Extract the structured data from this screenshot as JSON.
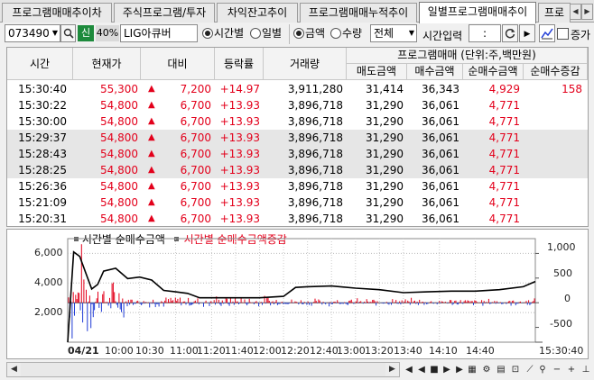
{
  "tabs": [
    {
      "label": "프로그램매매추이차",
      "active": false
    },
    {
      "label": "주식프로그램/투자",
      "active": false
    },
    {
      "label": "차익잔고추이",
      "active": false
    },
    {
      "label": "프로그램매매누적추이",
      "active": false
    },
    {
      "label": "일별프로그램매매추이",
      "active": true
    },
    {
      "label": "프로",
      "active": false
    }
  ],
  "toolbar": {
    "code": "073490",
    "credit_badge": "신",
    "margin_rate": "40%",
    "stock_name": "LIG아큐버",
    "view_by_time": "시간별",
    "view_by_day": "일별",
    "unit_amount": "금액",
    "unit_qty": "수량",
    "market_select": "전체",
    "time_input_label": "시간입력",
    "time_input_value": ":",
    "increase_label": "증가"
  },
  "table": {
    "headers": {
      "time": "시간",
      "price": "현재가",
      "change": "대비",
      "rate": "등락률",
      "volume": "거래량",
      "program": "프로그램매매 (단위:주,백만원)",
      "sell": "매도금액",
      "buy": "매수금액",
      "net": "순매수금액",
      "net_change": "순매수증감"
    },
    "rows": [
      {
        "time": "15:30:40",
        "price": "55,300",
        "change": "7,200",
        "rate": "+14.97",
        "volume": "3,911,280",
        "sell": "31,414",
        "buy": "36,343",
        "net": "4,929",
        "net_change": "158"
      },
      {
        "time": "15:30:22",
        "price": "54,800",
        "change": "6,700",
        "rate": "+13.93",
        "volume": "3,896,718",
        "sell": "31,290",
        "buy": "36,061",
        "net": "4,771",
        "net_change": ""
      },
      {
        "time": "15:30:00",
        "price": "54,800",
        "change": "6,700",
        "rate": "+13.93",
        "volume": "3,896,718",
        "sell": "31,290",
        "buy": "36,061",
        "net": "4,771",
        "net_change": ""
      },
      {
        "time": "15:29:37",
        "price": "54,800",
        "change": "6,700",
        "rate": "+13.93",
        "volume": "3,896,718",
        "sell": "31,290",
        "buy": "36,061",
        "net": "4,771",
        "net_change": ""
      },
      {
        "time": "15:28:43",
        "price": "54,800",
        "change": "6,700",
        "rate": "+13.93",
        "volume": "3,896,718",
        "sell": "31,290",
        "buy": "36,061",
        "net": "4,771",
        "net_change": ""
      },
      {
        "time": "15:28:25",
        "price": "54,800",
        "change": "6,700",
        "rate": "+13.93",
        "volume": "3,896,718",
        "sell": "31,290",
        "buy": "36,061",
        "net": "4,771",
        "net_change": ""
      },
      {
        "time": "15:26:36",
        "price": "54,800",
        "change": "6,700",
        "rate": "+13.93",
        "volume": "3,896,718",
        "sell": "31,290",
        "buy": "36,061",
        "net": "4,771",
        "net_change": ""
      },
      {
        "time": "15:21:09",
        "price": "54,800",
        "change": "6,700",
        "rate": "+13.93",
        "volume": "3,896,718",
        "sell": "31,290",
        "buy": "36,061",
        "net": "4,771",
        "net_change": ""
      },
      {
        "time": "15:20:31",
        "price": "54,800",
        "change": "6,700",
        "rate": "+13.93",
        "volume": "3,896,718",
        "sell": "31,290",
        "buy": "36,061",
        "net": "4,771",
        "net_change": ""
      }
    ]
  },
  "chart": {
    "legend_black": "시간별 순매수금액",
    "legend_red": "시간별 순매수금액증감",
    "left_ticks": [
      "6,000",
      "4,000",
      "2,000"
    ],
    "right_ticks": [
      "1,000",
      "500",
      "0",
      "-500"
    ],
    "x_labels": [
      "04/21",
      "10:00",
      "10:30",
      "11:00",
      "11:20",
      "11:40",
      "12:00",
      "12:20",
      "12:40",
      "13:00",
      "13:20",
      "13:40",
      "14:10",
      "14:40",
      "15:30:40"
    ]
  },
  "chart_data": {
    "type": "line",
    "title": "",
    "series": [
      {
        "name": "시간별 순매수금액",
        "axis": "left",
        "x": [
          "09:00",
          "09:05",
          "09:10",
          "09:15",
          "09:20",
          "09:25",
          "09:30",
          "09:40",
          "09:50",
          "10:00",
          "10:10",
          "10:20",
          "10:30",
          "10:40",
          "10:50",
          "11:00",
          "11:20",
          "11:40",
          "12:00",
          "12:10",
          "12:20",
          "12:40",
          "13:00",
          "13:20",
          "13:40",
          "14:00",
          "14:20",
          "14:40",
          "15:00",
          "15:20",
          "15:30"
        ],
        "values": [
          0,
          6100,
          5800,
          4700,
          3600,
          3900,
          4800,
          5000,
          4300,
          4400,
          4200,
          3500,
          3400,
          3300,
          3000,
          3000,
          3000,
          3000,
          3100,
          3700,
          3750,
          3800,
          3650,
          3550,
          3350,
          3400,
          3450,
          3450,
          3550,
          3750,
          4100
        ]
      },
      {
        "name": "시간별 순매수금액증감",
        "axis": "right",
        "note_type": "bar",
        "x": [
          "09:05",
          "09:15",
          "09:30",
          "10:00",
          "10:30",
          "11:00",
          "12:00",
          "12:10",
          "13:00",
          "14:00",
          "15:00",
          "15:30"
        ],
        "values": [
          1050,
          500,
          300,
          200,
          120,
          80,
          60,
          120,
          40,
          30,
          60,
          158
        ]
      }
    ],
    "ylim_left": [
      0,
      7000
    ],
    "ylim_right": [
      -800,
      1300
    ],
    "grid": true
  },
  "colors": {
    "up_red": "#e3001b",
    "down_blue": "#1f3bd6",
    "line_black": "#000000",
    "header_bg": "#f3f3f3",
    "alt_row": "#e6e6e6"
  }
}
